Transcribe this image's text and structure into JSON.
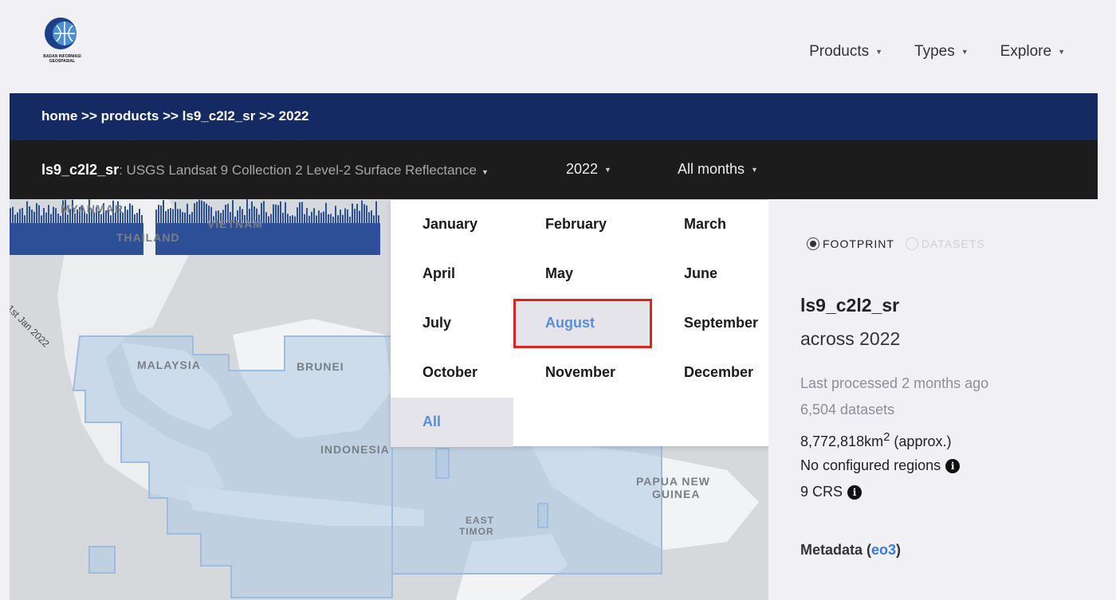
{
  "logo": {
    "text_line1": "BADAN INFORMASI",
    "text_line2": "GEOSPASIAL"
  },
  "nav": {
    "items": [
      {
        "label": "Products"
      },
      {
        "label": "Types"
      },
      {
        "label": "Explore"
      }
    ]
  },
  "breadcrumb": {
    "text": "home >> products >> ls9_c2l2_sr >> 2022"
  },
  "product_bar": {
    "product_name": "ls9_c2l2_sr",
    "product_desc": ": USGS Landsat 9 Collection 2 Level-2 Surface Reflectance",
    "year": "2022",
    "month": "All months"
  },
  "map": {
    "labels": {
      "myanmar": "MYANMAR",
      "vietnam": "VIETNAM",
      "thailand": "THAILAND",
      "malaysia": "MALAYSIA",
      "brunei": "BRUNEI",
      "indonesia": "INDONESIA",
      "papua1": "PAPUA NEW",
      "papua2": "GUINEA",
      "timor1": "EAST",
      "timor2": "TIMOR"
    },
    "timeline_start_label": "1st Jan 2022"
  },
  "dropdown": {
    "months": [
      {
        "label": "January"
      },
      {
        "label": "February"
      },
      {
        "label": "March"
      },
      {
        "label": "April"
      },
      {
        "label": "May"
      },
      {
        "label": "June"
      },
      {
        "label": "July"
      },
      {
        "label": "August"
      },
      {
        "label": "September"
      },
      {
        "label": "October"
      },
      {
        "label": "November"
      },
      {
        "label": "December"
      }
    ],
    "all_label": "All"
  },
  "panel": {
    "toggle_footprint": "FOOTPRINT",
    "toggle_datasets": "DATASETS",
    "title": "ls9_c2l2_sr",
    "subtitle": "across 2022",
    "last_processed": "Last processed 2 months ago",
    "datasets": "6,504 datasets",
    "area": "8,772,818km",
    "area_sup": "2",
    "area_suffix": " (approx.)",
    "regions": "No configured regions",
    "crs": "9 CRS",
    "metadata_label": "Metadata (",
    "metadata_link": "eo3",
    "metadata_close": ")"
  },
  "colors": {
    "navy": "#152a63",
    "dark_bar": "#1c1c1c",
    "accent": "#5b8fdb",
    "highlight_box": "#d92424"
  }
}
